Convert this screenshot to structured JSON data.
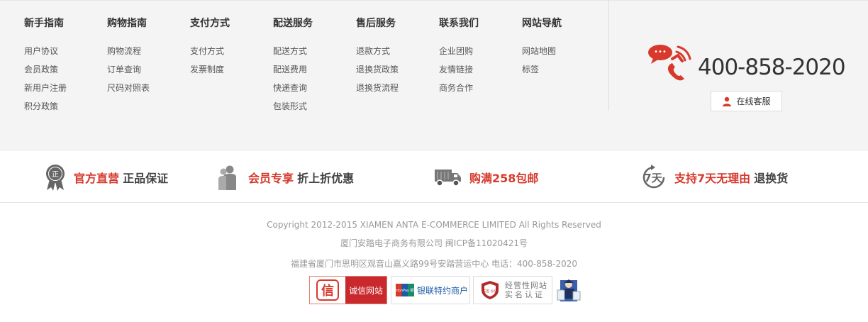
{
  "columns": [
    {
      "title": "新手指南",
      "links": [
        "用户协议",
        "会员政策",
        "新用户注册",
        "积分政策"
      ]
    },
    {
      "title": "购物指南",
      "links": [
        "购物流程",
        "订单查询",
        "尺码对照表"
      ]
    },
    {
      "title": "支付方式",
      "links": [
        "支付方式",
        "发票制度"
      ]
    },
    {
      "title": "配送服务",
      "links": [
        "配送方式",
        "配送费用",
        "快递查询",
        "包装形式"
      ]
    },
    {
      "title": "售后服务",
      "links": [
        "退款方式",
        "退换货政策",
        "退换货流程"
      ]
    },
    {
      "title": "联系我们",
      "links": [
        "企业团购",
        "友情链接",
        "商务合作"
      ]
    },
    {
      "title": "网站导航",
      "links": [
        "网站地图",
        "标签"
      ]
    }
  ],
  "contact": {
    "phone": "400-858-2020",
    "online_service": "在线客服",
    "bubble_text": "•••"
  },
  "promos": [
    {
      "icon": "medal-icon",
      "icon_text": "正",
      "red": "官方直营",
      "gray": "正品保证"
    },
    {
      "icon": "members-icon",
      "red": "会员专享",
      "gray": "折上折优惠"
    },
    {
      "icon": "truck-icon",
      "red": "购满258包邮",
      "gray": ""
    },
    {
      "icon": "seven-days-icon",
      "icon_text": "7天",
      "red": "支持7天无理由",
      "gray": "退换货"
    }
  ],
  "legal": {
    "copyright": "Copyright 2012-2015 XIAMEN ANTA E-COMMERCE LIMITED All Rights Reserved",
    "company": "厦门安踏电子商务有限公司 闽ICP备11020421号",
    "address": "福建省厦门市思明区观音山嘉义路99号安踏营运中心 电话：400-858-2020"
  },
  "badges": {
    "credit_logo": "信",
    "credit": "诚信网站",
    "unionpay_logo": "UnionPay 银联",
    "unionpay": "银联特约商户",
    "business_line1": "经营性网站",
    "business_line2": "实名认证",
    "business_logo": "实名 认证"
  },
  "colors": {
    "accent": "#d7392c",
    "footer_bg": "#f4f4f4"
  }
}
